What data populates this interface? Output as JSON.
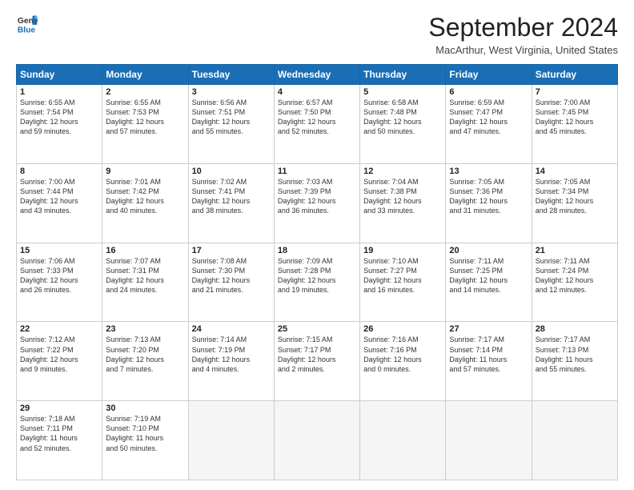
{
  "header": {
    "logo_line1": "General",
    "logo_line2": "Blue",
    "month_title": "September 2024",
    "location": "MacArthur, West Virginia, United States"
  },
  "weekdays": [
    "Sunday",
    "Monday",
    "Tuesday",
    "Wednesday",
    "Thursday",
    "Friday",
    "Saturday"
  ],
  "weeks": [
    [
      {
        "day": "1",
        "sunrise": "Sunrise: 6:55 AM",
        "sunset": "Sunset: 7:54 PM",
        "daylight": "Daylight: 12 hours",
        "daylight2": "and 59 minutes."
      },
      {
        "day": "2",
        "sunrise": "Sunrise: 6:55 AM",
        "sunset": "Sunset: 7:53 PM",
        "daylight": "Daylight: 12 hours",
        "daylight2": "and 57 minutes."
      },
      {
        "day": "3",
        "sunrise": "Sunrise: 6:56 AM",
        "sunset": "Sunset: 7:51 PM",
        "daylight": "Daylight: 12 hours",
        "daylight2": "and 55 minutes."
      },
      {
        "day": "4",
        "sunrise": "Sunrise: 6:57 AM",
        "sunset": "Sunset: 7:50 PM",
        "daylight": "Daylight: 12 hours",
        "daylight2": "and 52 minutes."
      },
      {
        "day": "5",
        "sunrise": "Sunrise: 6:58 AM",
        "sunset": "Sunset: 7:48 PM",
        "daylight": "Daylight: 12 hours",
        "daylight2": "and 50 minutes."
      },
      {
        "day": "6",
        "sunrise": "Sunrise: 6:59 AM",
        "sunset": "Sunset: 7:47 PM",
        "daylight": "Daylight: 12 hours",
        "daylight2": "and 47 minutes."
      },
      {
        "day": "7",
        "sunrise": "Sunrise: 7:00 AM",
        "sunset": "Sunset: 7:45 PM",
        "daylight": "Daylight: 12 hours",
        "daylight2": "and 45 minutes."
      }
    ],
    [
      {
        "day": "8",
        "sunrise": "Sunrise: 7:00 AM",
        "sunset": "Sunset: 7:44 PM",
        "daylight": "Daylight: 12 hours",
        "daylight2": "and 43 minutes."
      },
      {
        "day": "9",
        "sunrise": "Sunrise: 7:01 AM",
        "sunset": "Sunset: 7:42 PM",
        "daylight": "Daylight: 12 hours",
        "daylight2": "and 40 minutes."
      },
      {
        "day": "10",
        "sunrise": "Sunrise: 7:02 AM",
        "sunset": "Sunset: 7:41 PM",
        "daylight": "Daylight: 12 hours",
        "daylight2": "and 38 minutes."
      },
      {
        "day": "11",
        "sunrise": "Sunrise: 7:03 AM",
        "sunset": "Sunset: 7:39 PM",
        "daylight": "Daylight: 12 hours",
        "daylight2": "and 36 minutes."
      },
      {
        "day": "12",
        "sunrise": "Sunrise: 7:04 AM",
        "sunset": "Sunset: 7:38 PM",
        "daylight": "Daylight: 12 hours",
        "daylight2": "and 33 minutes."
      },
      {
        "day": "13",
        "sunrise": "Sunrise: 7:05 AM",
        "sunset": "Sunset: 7:36 PM",
        "daylight": "Daylight: 12 hours",
        "daylight2": "and 31 minutes."
      },
      {
        "day": "14",
        "sunrise": "Sunrise: 7:05 AM",
        "sunset": "Sunset: 7:34 PM",
        "daylight": "Daylight: 12 hours",
        "daylight2": "and 28 minutes."
      }
    ],
    [
      {
        "day": "15",
        "sunrise": "Sunrise: 7:06 AM",
        "sunset": "Sunset: 7:33 PM",
        "daylight": "Daylight: 12 hours",
        "daylight2": "and 26 minutes."
      },
      {
        "day": "16",
        "sunrise": "Sunrise: 7:07 AM",
        "sunset": "Sunset: 7:31 PM",
        "daylight": "Daylight: 12 hours",
        "daylight2": "and 24 minutes."
      },
      {
        "day": "17",
        "sunrise": "Sunrise: 7:08 AM",
        "sunset": "Sunset: 7:30 PM",
        "daylight": "Daylight: 12 hours",
        "daylight2": "and 21 minutes."
      },
      {
        "day": "18",
        "sunrise": "Sunrise: 7:09 AM",
        "sunset": "Sunset: 7:28 PM",
        "daylight": "Daylight: 12 hours",
        "daylight2": "and 19 minutes."
      },
      {
        "day": "19",
        "sunrise": "Sunrise: 7:10 AM",
        "sunset": "Sunset: 7:27 PM",
        "daylight": "Daylight: 12 hours",
        "daylight2": "and 16 minutes."
      },
      {
        "day": "20",
        "sunrise": "Sunrise: 7:11 AM",
        "sunset": "Sunset: 7:25 PM",
        "daylight": "Daylight: 12 hours",
        "daylight2": "and 14 minutes."
      },
      {
        "day": "21",
        "sunrise": "Sunrise: 7:11 AM",
        "sunset": "Sunset: 7:24 PM",
        "daylight": "Daylight: 12 hours",
        "daylight2": "and 12 minutes."
      }
    ],
    [
      {
        "day": "22",
        "sunrise": "Sunrise: 7:12 AM",
        "sunset": "Sunset: 7:22 PM",
        "daylight": "Daylight: 12 hours",
        "daylight2": "and 9 minutes."
      },
      {
        "day": "23",
        "sunrise": "Sunrise: 7:13 AM",
        "sunset": "Sunset: 7:20 PM",
        "daylight": "Daylight: 12 hours",
        "daylight2": "and 7 minutes."
      },
      {
        "day": "24",
        "sunrise": "Sunrise: 7:14 AM",
        "sunset": "Sunset: 7:19 PM",
        "daylight": "Daylight: 12 hours",
        "daylight2": "and 4 minutes."
      },
      {
        "day": "25",
        "sunrise": "Sunrise: 7:15 AM",
        "sunset": "Sunset: 7:17 PM",
        "daylight": "Daylight: 12 hours",
        "daylight2": "and 2 minutes."
      },
      {
        "day": "26",
        "sunrise": "Sunrise: 7:16 AM",
        "sunset": "Sunset: 7:16 PM",
        "daylight": "Daylight: 12 hours",
        "daylight2": "and 0 minutes."
      },
      {
        "day": "27",
        "sunrise": "Sunrise: 7:17 AM",
        "sunset": "Sunset: 7:14 PM",
        "daylight": "Daylight: 11 hours",
        "daylight2": "and 57 minutes."
      },
      {
        "day": "28",
        "sunrise": "Sunrise: 7:17 AM",
        "sunset": "Sunset: 7:13 PM",
        "daylight": "Daylight: 11 hours",
        "daylight2": "and 55 minutes."
      }
    ],
    [
      {
        "day": "29",
        "sunrise": "Sunrise: 7:18 AM",
        "sunset": "Sunset: 7:11 PM",
        "daylight": "Daylight: 11 hours",
        "daylight2": "and 52 minutes."
      },
      {
        "day": "30",
        "sunrise": "Sunrise: 7:19 AM",
        "sunset": "Sunset: 7:10 PM",
        "daylight": "Daylight: 11 hours",
        "daylight2": "and 50 minutes."
      },
      null,
      null,
      null,
      null,
      null
    ]
  ]
}
